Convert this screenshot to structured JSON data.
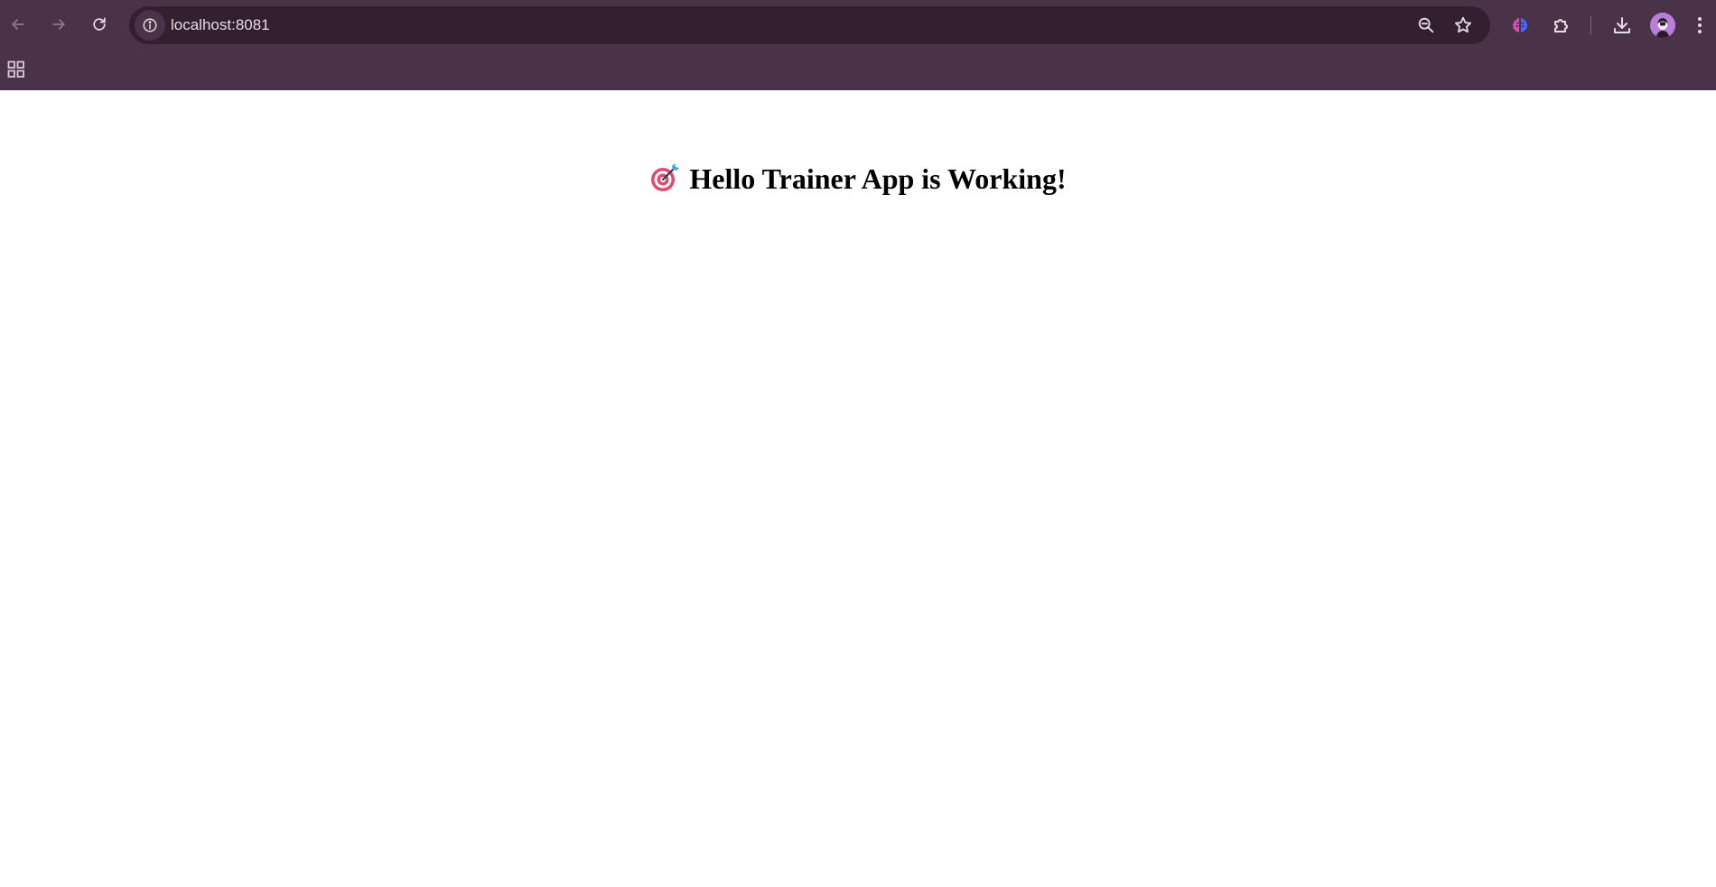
{
  "browser": {
    "url": "localhost:8081",
    "colors": {
      "frame": "#4a3349",
      "omnibox": "#321f30",
      "icon": "#e6dce5",
      "icon_disabled": "#8c7a8a"
    },
    "icons": {
      "back": "arrow-left-icon",
      "forward": "arrow-right-icon",
      "reload": "reload-icon",
      "site_info": "info-icon",
      "zoom": "zoom-out-icon",
      "bookmark": "star-icon",
      "extension_brain": "brain-icon",
      "extensions": "puzzle-icon",
      "downloads": "download-icon",
      "menu": "kebab-menu-icon",
      "apps": "apps-grid-icon"
    }
  },
  "page": {
    "heading_emoji": "target-icon",
    "heading": "Hello Trainer App is Working!"
  }
}
